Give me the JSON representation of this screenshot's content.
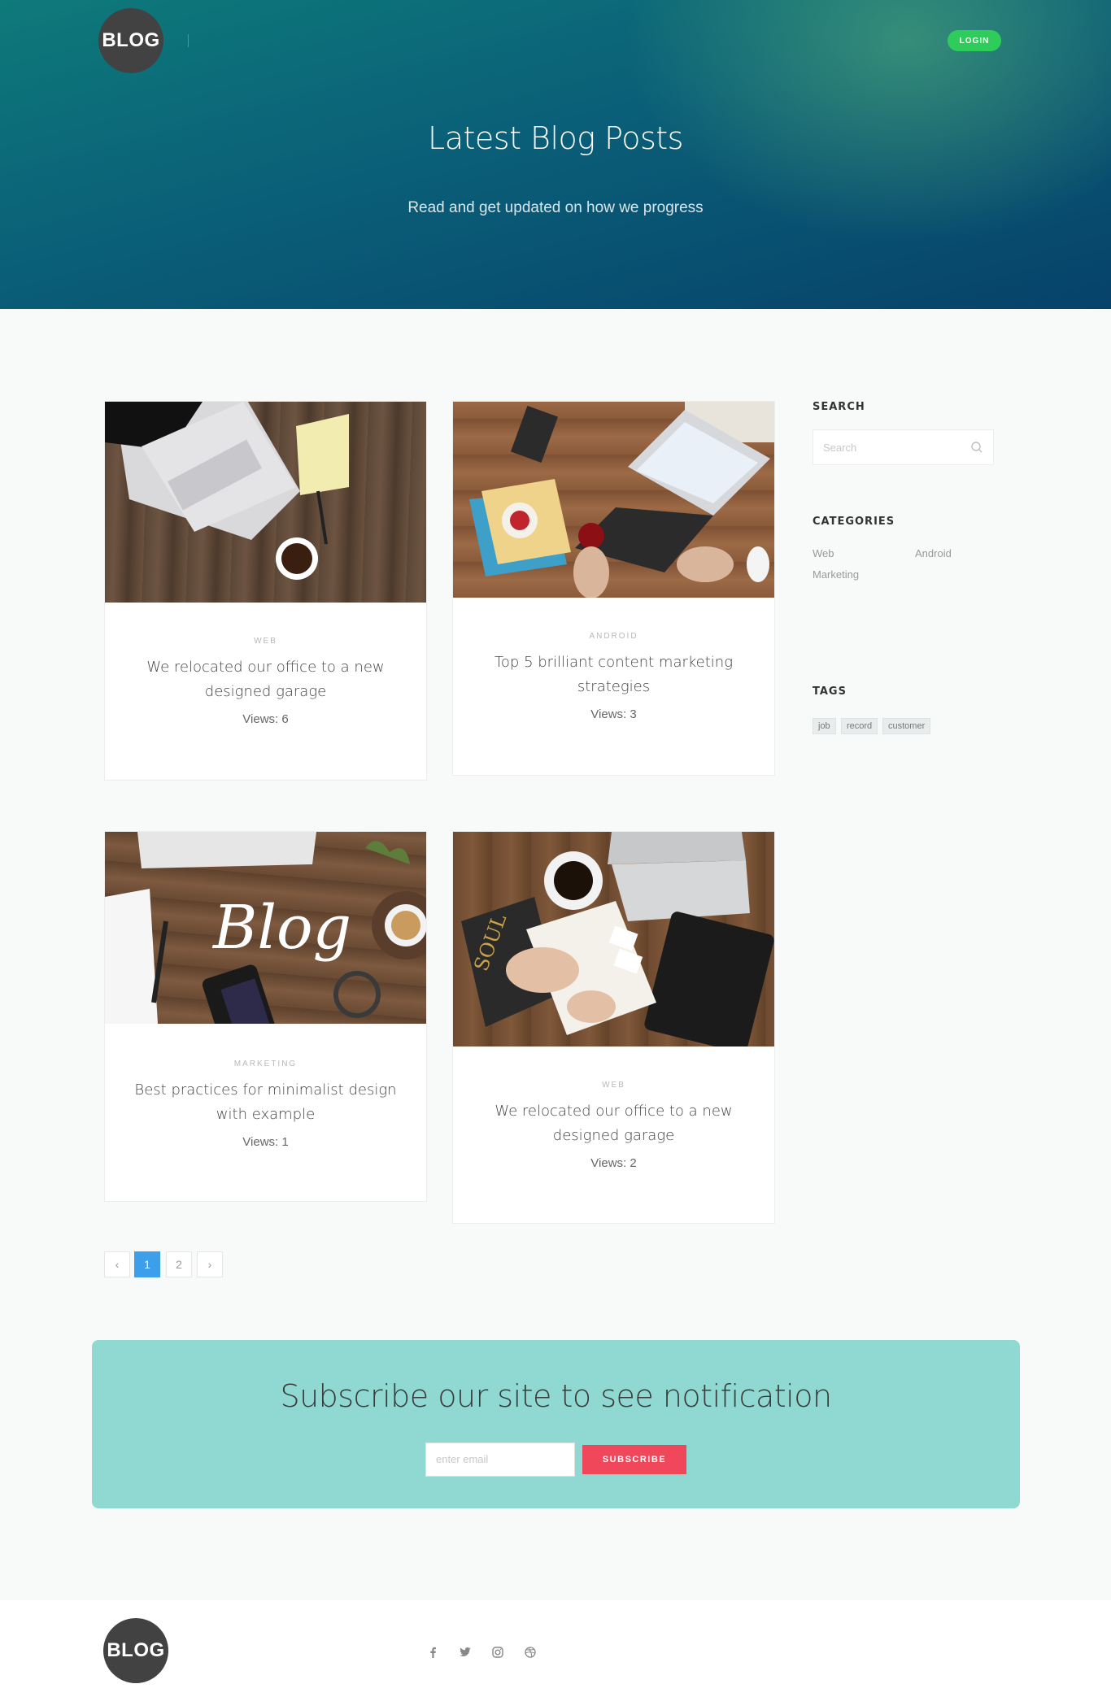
{
  "header": {
    "logo_text": "BLOG",
    "login_label": "LOGIN",
    "title": "Latest Blog Posts",
    "subtitle": "Read and get updated on how we progress"
  },
  "posts": [
    {
      "category": "WEB",
      "title": "We relocated our office to a new designed garage",
      "views": "Views: 6",
      "image": "laptop-notepad-coffee"
    },
    {
      "category": "ANDROID",
      "title": "Top 5 brilliant content marketing strategies",
      "views": "Views: 3",
      "image": "laptop-desk-blog"
    },
    {
      "category": "MARKETING",
      "title": "Best practices for minimalist design with example",
      "views": "Views: 1",
      "image": "blog-lettering-desk"
    },
    {
      "category": "WEB",
      "title": "We relocated our office to a new designed garage",
      "views": "Views: 2",
      "image": "desk-notebook-tablet"
    }
  ],
  "sidebar": {
    "search_heading": "SEARCH",
    "search_placeholder": "Search",
    "categories_heading": "CATEGORIES",
    "categories": [
      "Web",
      "Android",
      "Marketing"
    ],
    "tags_heading": "TAGS",
    "tags": [
      "job",
      "record",
      "customer"
    ]
  },
  "pagination": {
    "prev": "‹",
    "pages": [
      "1",
      "2"
    ],
    "active": "1",
    "next": "›"
  },
  "subscribe": {
    "heading": "Subscribe our site to see notification",
    "placeholder": "enter email",
    "button": "SUBSCRIBE"
  },
  "footer": {
    "logo_text": "BLOG",
    "social": [
      "facebook-icon",
      "twitter-icon",
      "instagram-icon",
      "dribbble-icon"
    ]
  },
  "colors": {
    "accent_green": "#2ecc5a",
    "active_page": "#3d9eea",
    "subscribe_bg": "#90d9d2",
    "subscribe_btn": "#f0475a"
  }
}
